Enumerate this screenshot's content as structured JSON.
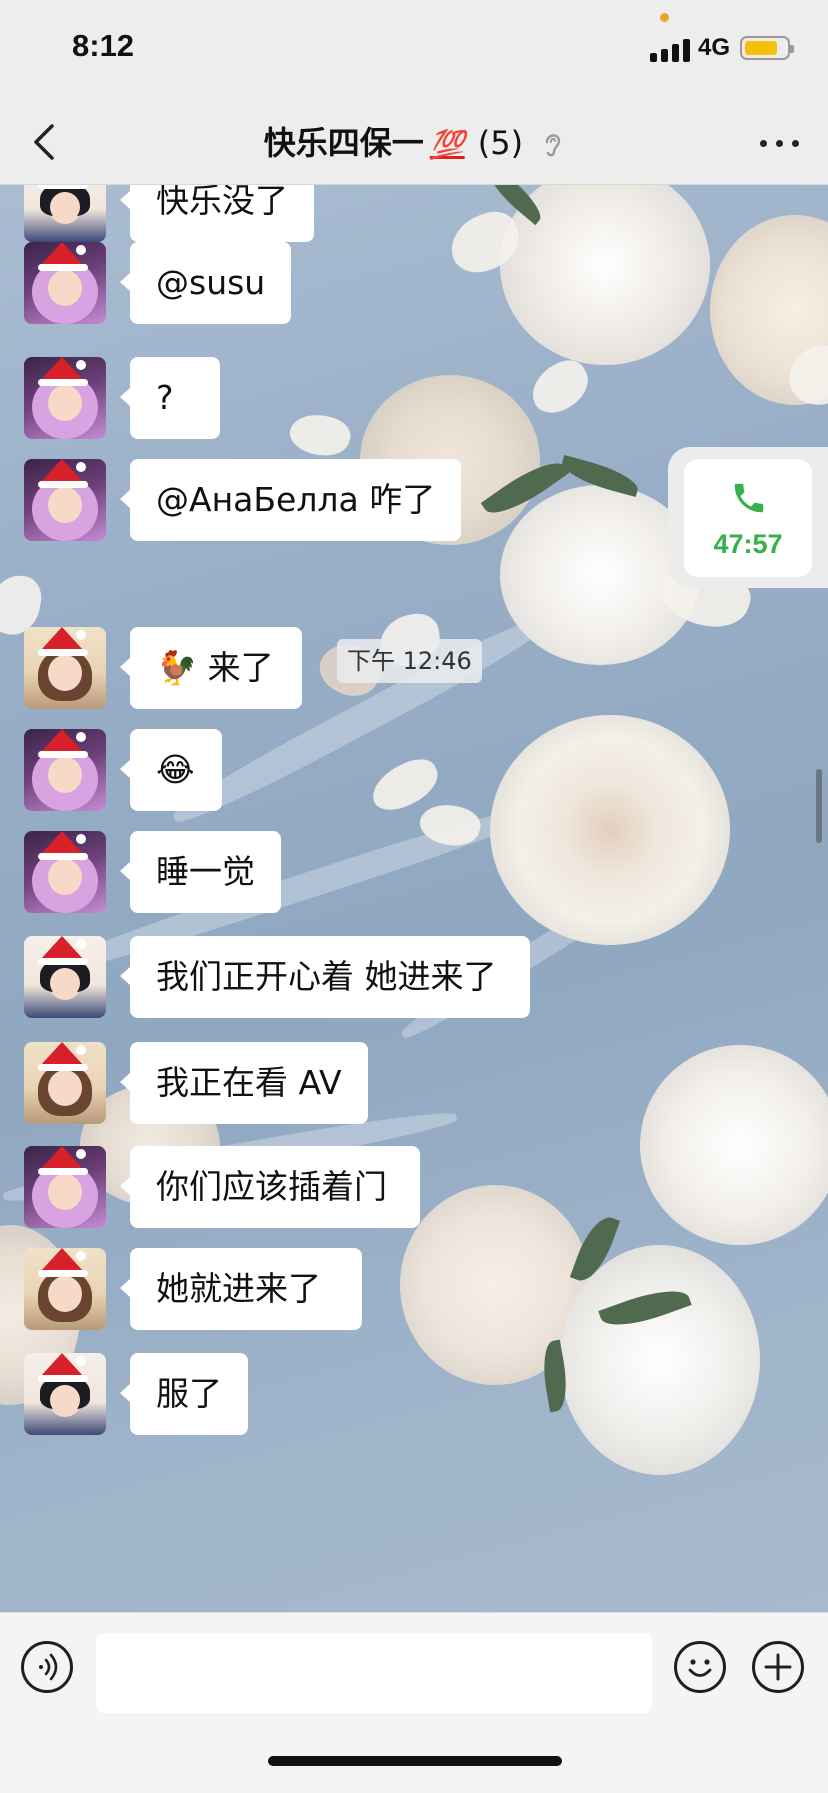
{
  "status_bar": {
    "time": "8:12",
    "network": "4G",
    "battery_level": 0.8,
    "battery_color": "#f4c20d"
  },
  "nav": {
    "back_icon": "chevron-left-icon",
    "title": "快乐四保一",
    "title_emoji": "💯",
    "member_count": "(5)",
    "muted_icon": "ear-icon",
    "more_icon": "more-dots-icon"
  },
  "call": {
    "icon": "phone-icon",
    "duration": "47:57",
    "accent": "#36b04a"
  },
  "timestamp": "下午 12:46",
  "messages": [
    {
      "avatar": "snow-white",
      "text": "快乐没了"
    },
    {
      "avatar": "anime-girl",
      "text": "@susu"
    },
    {
      "avatar": "anime-girl",
      "text": "?"
    },
    {
      "avatar": "anime-girl",
      "text": "@АнаБелла 咋了"
    },
    {
      "avatar": "photo-girl",
      "text": "🐓 来了"
    },
    {
      "avatar": "anime-girl",
      "text": "😂"
    },
    {
      "avatar": "anime-girl",
      "text": "睡一觉"
    },
    {
      "avatar": "snow-white",
      "text": "我们正开心着 她进来了"
    },
    {
      "avatar": "photo-girl",
      "text": "我正在看 AV"
    },
    {
      "avatar": "anime-girl",
      "text": "你们应该插着门"
    },
    {
      "avatar": "photo-girl",
      "text": "她就进来了"
    },
    {
      "avatar": "snow-white",
      "text": "服了"
    }
  ],
  "input_bar": {
    "voice_icon": "voice-icon",
    "input_value": "",
    "emoji_icon": "smiley-icon",
    "plus_icon": "plus-icon"
  }
}
